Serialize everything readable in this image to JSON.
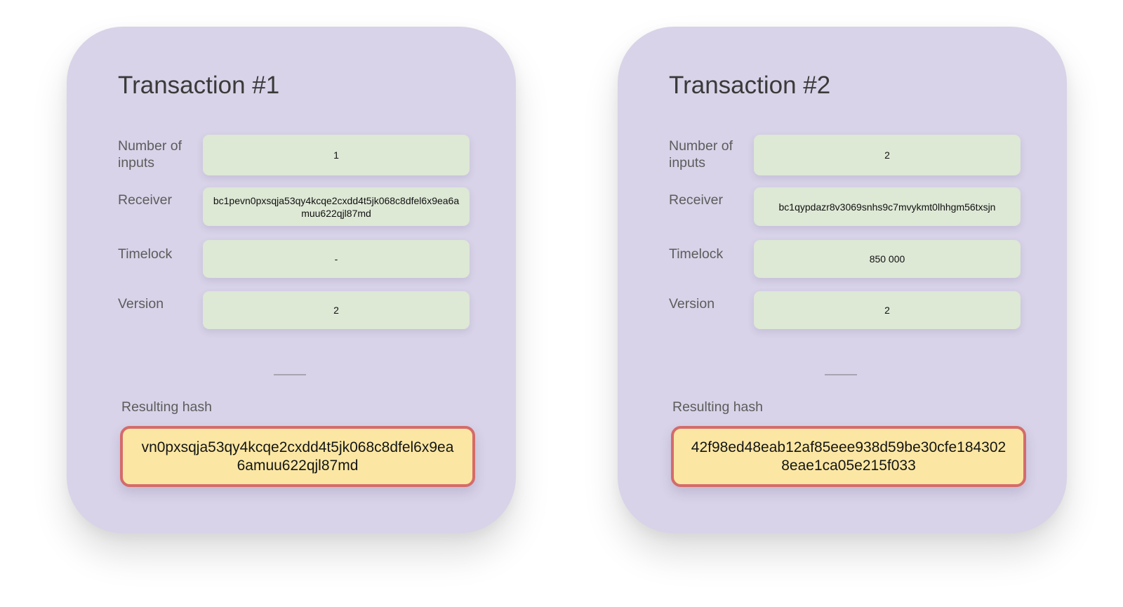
{
  "transactions": [
    {
      "title": "Transaction #1",
      "fields": [
        {
          "label": "Number of inputs",
          "value": "1"
        },
        {
          "label": "Receiver",
          "value": "bc1pevn0pxsqja53qy4kcqe2cxdd4t5jk068c8dfel6x9ea6amuu622qjl87md"
        },
        {
          "label": "Timelock",
          "value": "-"
        },
        {
          "label": "Version",
          "value": "2"
        }
      ],
      "hash_label": "Resulting hash",
      "hash_value": "vn0pxsqja53qy4kcqe2cxdd4t5jk068c8dfel6x9ea6amuu622qjl87md"
    },
    {
      "title": "Transaction #2",
      "fields": [
        {
          "label": "Number of inputs",
          "value": "2"
        },
        {
          "label": "Receiver",
          "value": "bc1qypdazr8v3069snhs9c7mvykmt0lhhgm56txsjn"
        },
        {
          "label": "Timelock",
          "value": "850 000"
        },
        {
          "label": "Version",
          "value": "2"
        }
      ],
      "hash_label": "Resulting hash",
      "hash_value": "42f98ed48eab12af85eee938d59be30cfe1843028eae1ca05e215f033"
    }
  ],
  "colors": {
    "card_bg": "#d8d3e8",
    "field_bg": "#dde8d5",
    "hash_bg": "#fbe7a3",
    "hash_border": "#d46b6b"
  }
}
